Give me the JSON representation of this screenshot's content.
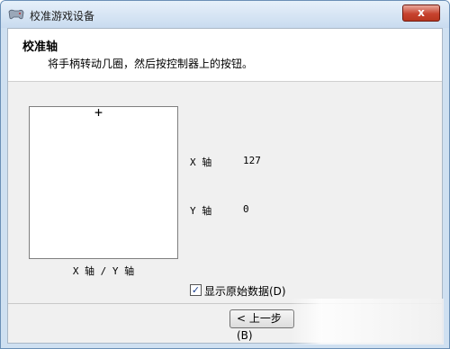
{
  "window": {
    "title": "校准游戏设备",
    "close_label": "x"
  },
  "header": {
    "title": "校准轴",
    "subtitle": "将手柄转动几圈，然后按控制器上的按钮。"
  },
  "axis_box": {
    "crosshair": "+",
    "caption": "X 轴 / Y 轴"
  },
  "axes": {
    "x_label": "X 轴",
    "x_value": "127",
    "y_label": "Y 轴",
    "y_value": "0"
  },
  "options": {
    "show_raw_checked": true,
    "show_raw_label": "显示原始数据(D)",
    "check_mark": "✓"
  },
  "buttons": {
    "back_label": "< 上一步(B)"
  }
}
